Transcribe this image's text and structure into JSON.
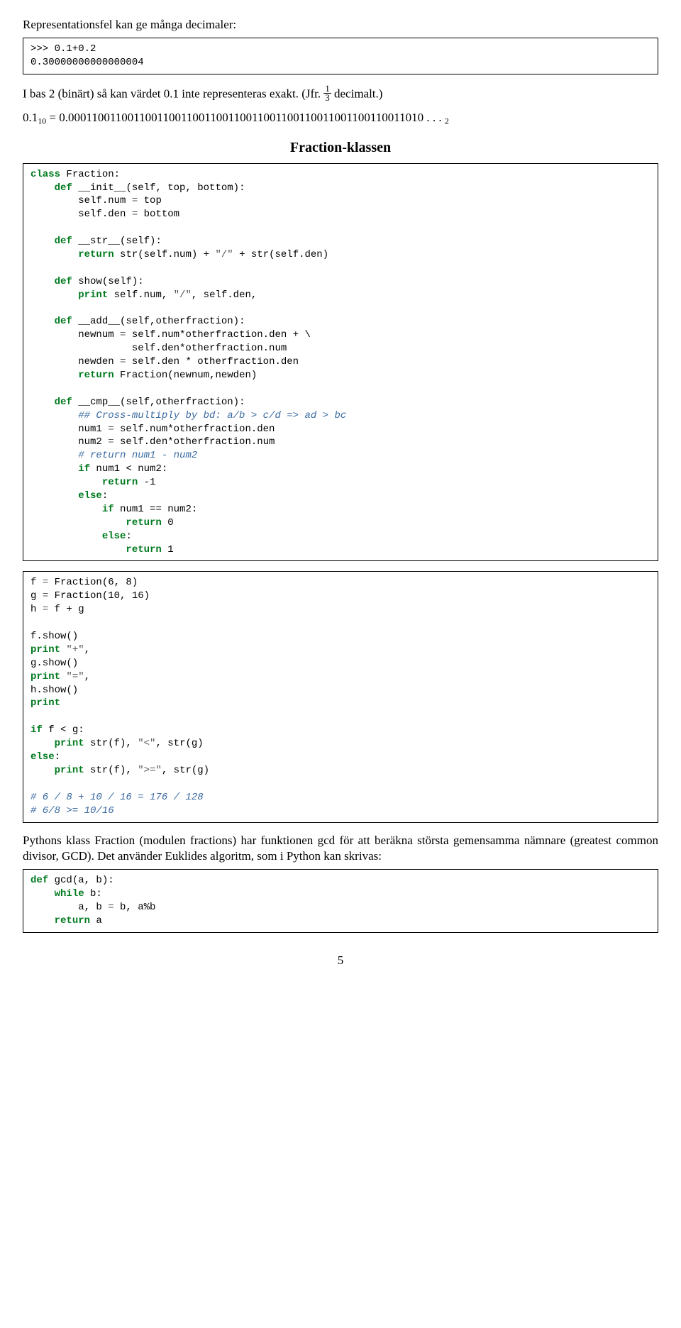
{
  "para1": "Representationsfel kan ge många decimaler:",
  "code_box_1": ">>> 0.1+0.2\n0.30000000000000004",
  "para2_a": "I bas 2 (binärt) så kan värdet 0.1 inte representeras exakt. (Jfr. ",
  "para2_frac_num": "1",
  "para2_frac_den": "3",
  "para2_b": " decimalt.)",
  "math_a": "0.1",
  "math_sub1": "10",
  "math_eq": " = 0.",
  "math_digits": "000110011001100110011001100110011001100110011001100110011010 . . . ",
  "math_sub2": "2",
  "section_title": "Fraction-klassen",
  "code_box_2_html": "<span class=\"kw\">class</span> Fraction:\n    <span class=\"kw\">def</span> __init__(self, top, bottom):\n        self.num <span class=\"op\">=</span> top\n        self.den <span class=\"op\">=</span> bottom\n\n    <span class=\"kw\">def</span> __str__(self):\n        <span class=\"kw\">return</span> str(self.num) + <span class=\"op\">\"/\"</span> + str(self.den)\n\n    <span class=\"kw\">def</span> show(self):\n        <span class=\"kw\">print</span> self.num, <span class=\"op\">\"/\"</span>, self.den,\n\n    <span class=\"kw\">def</span> __add__(self,otherfraction):\n        newnum <span class=\"op\">=</span> self.num*otherfraction.den + \\\n                 self.den*otherfraction.num\n        newden <span class=\"op\">=</span> self.den * otherfraction.den\n        <span class=\"kw\">return</span> Fraction(newnum,newden)\n\n    <span class=\"kw\">def</span> __cmp__(self,otherfraction):\n        <span class=\"cm\">## Cross-multiply by bd: a/b &gt; c/d =&gt; ad &gt; bc</span>\n        num1 <span class=\"op\">=</span> self.num*otherfraction.den\n        num2 <span class=\"op\">=</span> self.den*otherfraction.num\n        <span class=\"cm\"># return num1 - num2</span>\n        <span class=\"kw\">if</span> num1 &lt; num2:\n            <span class=\"kw\">return</span> -1\n        <span class=\"kw\">else</span>:\n            <span class=\"kw\">if</span> num1 == num2:\n                <span class=\"kw\">return</span> 0\n            <span class=\"kw\">else</span>:\n                <span class=\"kw\">return</span> 1",
  "code_box_3_html": "f <span class=\"op\">=</span> Fraction(6, 8)\ng <span class=\"op\">=</span> Fraction(10, 16)\nh <span class=\"op\">=</span> f + g\n\nf.show()\n<span class=\"kw\">print</span> <span class=\"op\">\"+\"</span>,\ng.show()\n<span class=\"kw\">print</span> <span class=\"op\">\"=\"</span>,\nh.show()\n<span class=\"kw\">print</span>\n\n<span class=\"kw\">if</span> f &lt; g:\n    <span class=\"kw\">print</span> str(f), <span class=\"op\">\"&lt;\"</span>, str(g)\n<span class=\"kw\">else</span>:\n    <span class=\"kw\">print</span> str(f), <span class=\"op\">\"&gt;=\"</span>, str(g)\n\n<span class=\"cm\"># 6 / 8 + 10 / 16 = 176 / 128</span>\n<span class=\"cm\"># 6/8 &gt;= 10/16</span>",
  "para3": "Pythons klass Fraction (modulen fractions) har funktionen gcd för att beräkna största gemensamma nämnare (greatest common divisor, GCD). Det använder Euklides algoritm, som i Python kan skrivas:",
  "code_box_4_html": "<span class=\"kw\">def</span> gcd(a, b):\n    <span class=\"kw\">while</span> b:\n        a, b <span class=\"op\">=</span> b, a%b\n    <span class=\"kw\">return</span> a",
  "page_num": "5"
}
